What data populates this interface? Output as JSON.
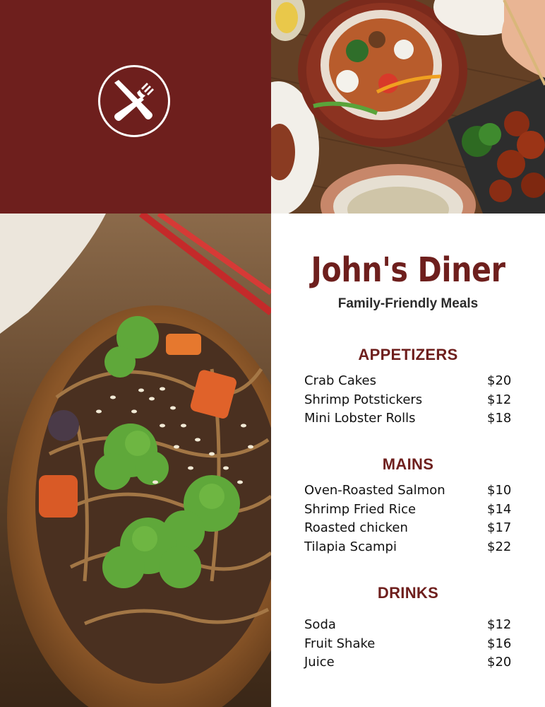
{
  "restaurant": {
    "name": "John's Diner",
    "tagline": "Family-Friendly Meals",
    "logo_icon": "knife-fork-icon",
    "brand_color": "#6e1f1d"
  },
  "menu": {
    "sections": [
      {
        "title": "APPETIZERS",
        "items": [
          {
            "name": "Crab Cakes",
            "price": "$20"
          },
          {
            "name": "Shrimp Potstickers",
            "price": "$12"
          },
          {
            "name": "Mini Lobster Rolls",
            "price": "$18"
          }
        ]
      },
      {
        "title": "MAINS",
        "items": [
          {
            "name": "Oven-Roasted Salmon",
            "price": "$10"
          },
          {
            "name": "Shrimp Fried Rice",
            "price": "$14"
          },
          {
            "name": "Roasted chicken",
            "price": "$17"
          },
          {
            "name": "Tilapia Scampi",
            "price": "$22"
          }
        ]
      },
      {
        "title": "DRINKS",
        "items": [
          {
            "name": "Soda",
            "price": "$12"
          },
          {
            "name": "Fruit Shake",
            "price": "$16"
          },
          {
            "name": "Juice",
            "price": "$20"
          }
        ]
      }
    ]
  }
}
